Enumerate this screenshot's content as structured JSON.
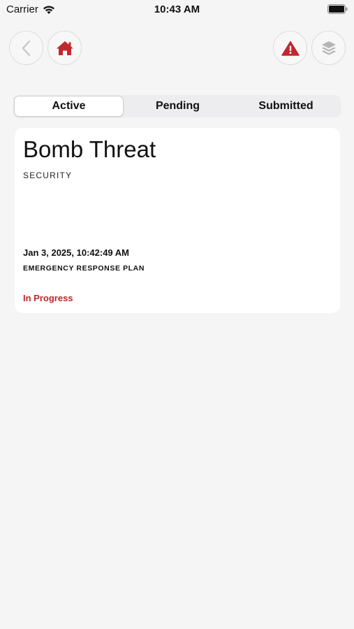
{
  "status_bar": {
    "carrier": "Carrier",
    "time": "10:43 AM"
  },
  "nav": {
    "back_icon": "chevron-left-icon",
    "home_icon": "home-icon",
    "alert_icon": "warning-triangle-icon",
    "layers_icon": "layers-icon"
  },
  "tabs": [
    {
      "label": "Active",
      "selected": true
    },
    {
      "label": "Pending",
      "selected": false
    },
    {
      "label": "Submitted",
      "selected": false
    }
  ],
  "incident": {
    "title": "Bomb Threat",
    "category": "SECURITY",
    "date": "Jan 3, 2025, 10:42:49 AM",
    "plan": "EMERGENCY RESPONSE PLAN",
    "status": "In Progress"
  },
  "colors": {
    "accent": "#c1272d",
    "background": "#f5f5f5",
    "card": "#ffffff"
  }
}
